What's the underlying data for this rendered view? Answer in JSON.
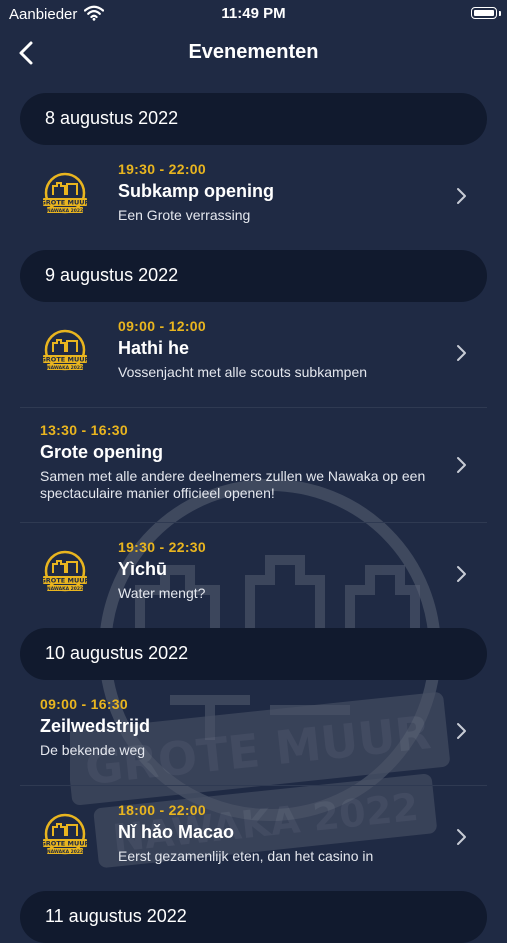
{
  "status": {
    "carrier": "Aanbieder",
    "time": "11:49 PM"
  },
  "nav": {
    "title": "Evenementen"
  },
  "watermark": {
    "line1": "GROTE MUUR",
    "line2": "NAWAKA 2022"
  },
  "logo": {
    "line1": "GROTE MUUR",
    "line2": "NAWAKA 2022"
  },
  "colors": {
    "background": "#1f2a44",
    "section": "#111a2e",
    "time": "#e9b51f"
  },
  "sections": [
    {
      "date": "8 augustus 2022",
      "events": [
        {
          "time": "19:30 - 22:00",
          "title": "Subkamp opening",
          "desc": "Een Grote verrassing",
          "logo": true
        }
      ]
    },
    {
      "date": "9 augustus 2022",
      "events": [
        {
          "time": "09:00 - 12:00",
          "title": "Hathi he",
          "desc": "Vossenjacht met alle scouts subkampen",
          "logo": true
        },
        {
          "time": "13:30 - 16:30",
          "title": "Grote opening",
          "desc": "Samen met alle andere deelnemers zullen we Nawaka op een spectaculaire manier officieel openen!",
          "logo": false
        },
        {
          "time": "19:30 - 22:30",
          "title": "Yìchū",
          "desc": "Water mengt?",
          "logo": true
        }
      ]
    },
    {
      "date": "10 augustus 2022",
      "events": [
        {
          "time": "09:00 - 16:30",
          "title": "Zeilwedstrijd",
          "desc": "De bekende weg",
          "logo": false
        },
        {
          "time": "18:00 - 22:00",
          "title": "Nǐ hǎo Macao",
          "desc": "Eerst gezamenlijk eten, dan het casino in",
          "logo": true
        }
      ]
    },
    {
      "date": "11 augustus 2022",
      "events": []
    }
  ]
}
